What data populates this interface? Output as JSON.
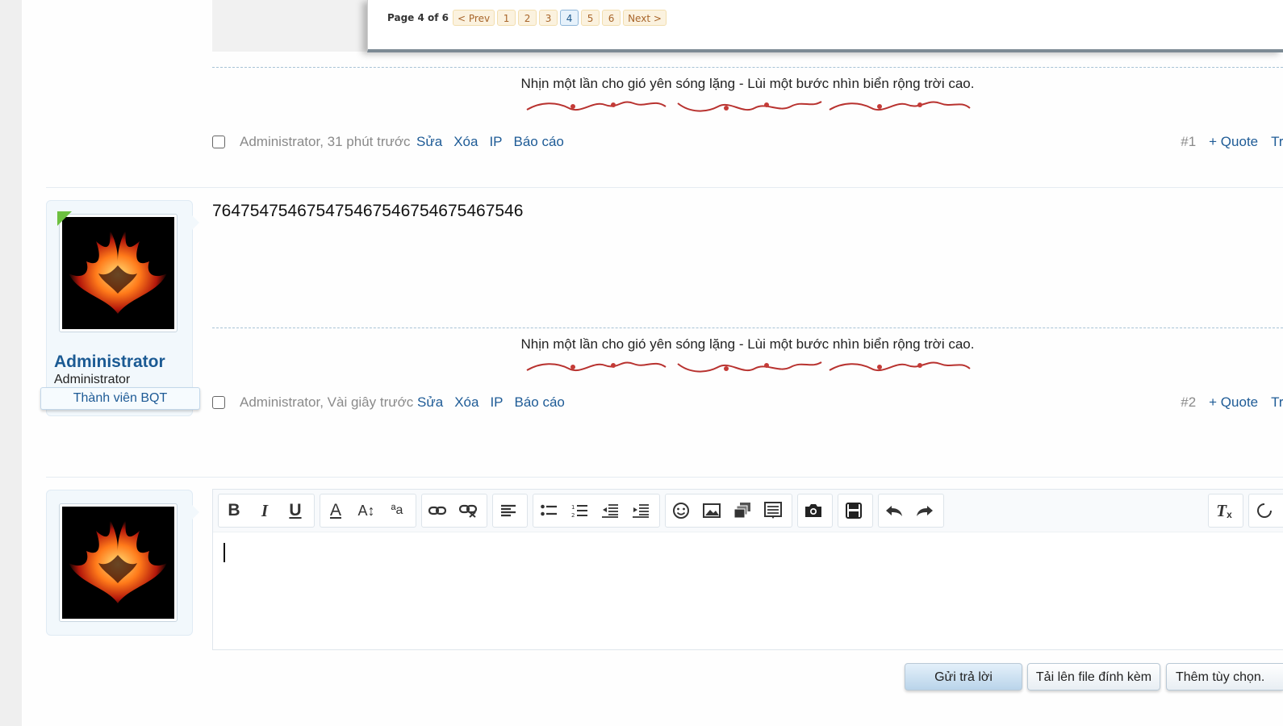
{
  "pagination": {
    "label": "Page 4 of 6",
    "prev": "< Prev",
    "pages": [
      "1",
      "2",
      "3",
      "4",
      "5",
      "6"
    ],
    "current": "4",
    "next": "Next >"
  },
  "signature": "Nhịn một lần cho gió yên sóng lặng - Lùi một bước nhìn biển rộng trời cao.",
  "posts": [
    {
      "meta": "Administrator, 31 phút trước",
      "actions": [
        "Sửa",
        "Xóa",
        "IP",
        "Báo cáo"
      ],
      "number": "#1",
      "quote": "+ Quote",
      "reply": "Trả"
    },
    {
      "body": "764754754675475467546754675467546",
      "meta": "Administrator, Vài giây trước",
      "actions": [
        "Sửa",
        "Xóa",
        "IP",
        "Báo cáo"
      ],
      "number": "#2",
      "quote": "+ Quote",
      "reply": "Trả"
    }
  ],
  "user": {
    "name": "Administrator",
    "title": "Administrator",
    "banner": "Thành viên BQT"
  },
  "editor": {
    "toolbar_icons": [
      "bold-icon",
      "italic-icon",
      "underline-icon",
      "text-color-icon",
      "font-size-icon",
      "font-family-icon",
      "link-icon",
      "unlink-icon",
      "align-icon",
      "bullet-list-icon",
      "numbered-list-icon",
      "outdent-icon",
      "indent-icon",
      "smiley-icon",
      "image-icon",
      "media-icon",
      "code-icon",
      "camera-icon",
      "save-draft-icon",
      "undo-icon",
      "redo-icon",
      "remove-format-icon"
    ]
  },
  "buttons": {
    "submit": "Gửi trả lời",
    "upload": "Tải lên file đính kèm",
    "more": "Thêm tùy chọn."
  },
  "colors": {
    "link": "#1e5b96",
    "username": "#1b5a93",
    "pager_bg": "#fbf2df",
    "online": "#6dc040"
  }
}
